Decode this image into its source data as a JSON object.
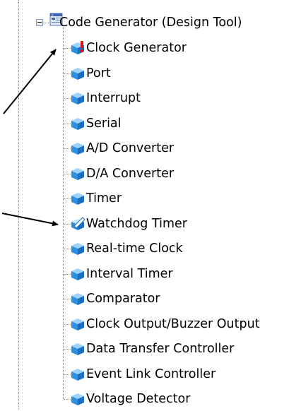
{
  "tree": {
    "root": {
      "label": "Code Generator (Design Tool)",
      "icon": "code-generator-icon",
      "expanded": true
    },
    "items": [
      {
        "label": "Clock Generator",
        "icon": "module-warning-icon"
      },
      {
        "label": "Port",
        "icon": "module-icon"
      },
      {
        "label": "Interrupt",
        "icon": "module-icon"
      },
      {
        "label": "Serial",
        "icon": "module-icon"
      },
      {
        "label": "A/D Converter",
        "icon": "module-icon"
      },
      {
        "label": "D/A Converter",
        "icon": "module-icon"
      },
      {
        "label": "Timer",
        "icon": "module-icon"
      },
      {
        "label": "Watchdog Timer",
        "icon": "module-edit-icon"
      },
      {
        "label": "Real-time Clock",
        "icon": "module-icon"
      },
      {
        "label": "Interval Timer",
        "icon": "module-icon"
      },
      {
        "label": "Comparator",
        "icon": "module-icon"
      },
      {
        "label": "Clock Output/Buzzer Output",
        "icon": "module-icon"
      },
      {
        "label": "Data Transfer Controller",
        "icon": "module-icon"
      },
      {
        "label": "Event Link Controller",
        "icon": "module-icon"
      },
      {
        "label": "Voltage Detector",
        "icon": "module-icon"
      }
    ]
  },
  "colors": {
    "module_blue": "#2f8fe0",
    "warning_red": "#e01010",
    "guide_line": "#8a8a8a"
  }
}
